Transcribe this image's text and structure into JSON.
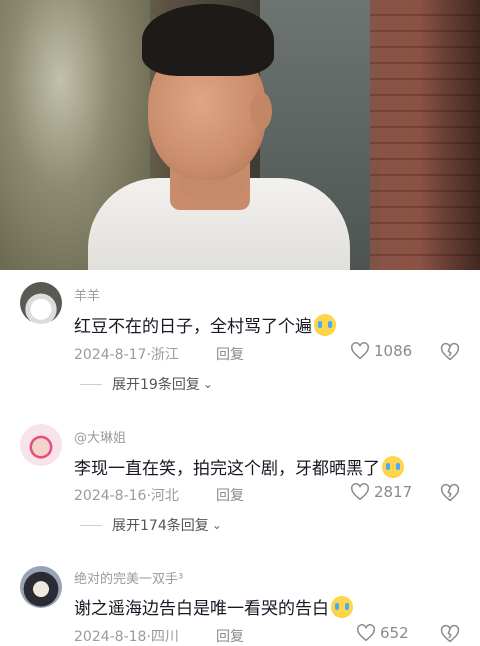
{
  "video": {
    "description_icon": "video-still"
  },
  "comments": [
    {
      "username": "羊羊",
      "text": "红豆不在的日子，全村骂了个遍",
      "emoji": "crying-face-emoji",
      "date": "2024-8-17",
      "location": "浙江",
      "reply_label": "回复",
      "likes": "1086",
      "expand_label": "展开19条回复"
    },
    {
      "username": "@大琳姐",
      "text": "李现一直在笑，拍完这个剧，牙都晒黑了",
      "emoji": "laughing-crying-emoji",
      "date": "2024-8-16",
      "location": "河北",
      "reply_label": "回复",
      "likes": "2817",
      "expand_label": "展开174条回复"
    },
    {
      "username": "绝对的完美一双手³",
      "text": "谢之遥海边告白是唯一看哭的告白",
      "emoji": "crying-face-emoji",
      "date": "2024-8-18",
      "location": "四川",
      "reply_label": "回复",
      "likes": "652"
    }
  ]
}
